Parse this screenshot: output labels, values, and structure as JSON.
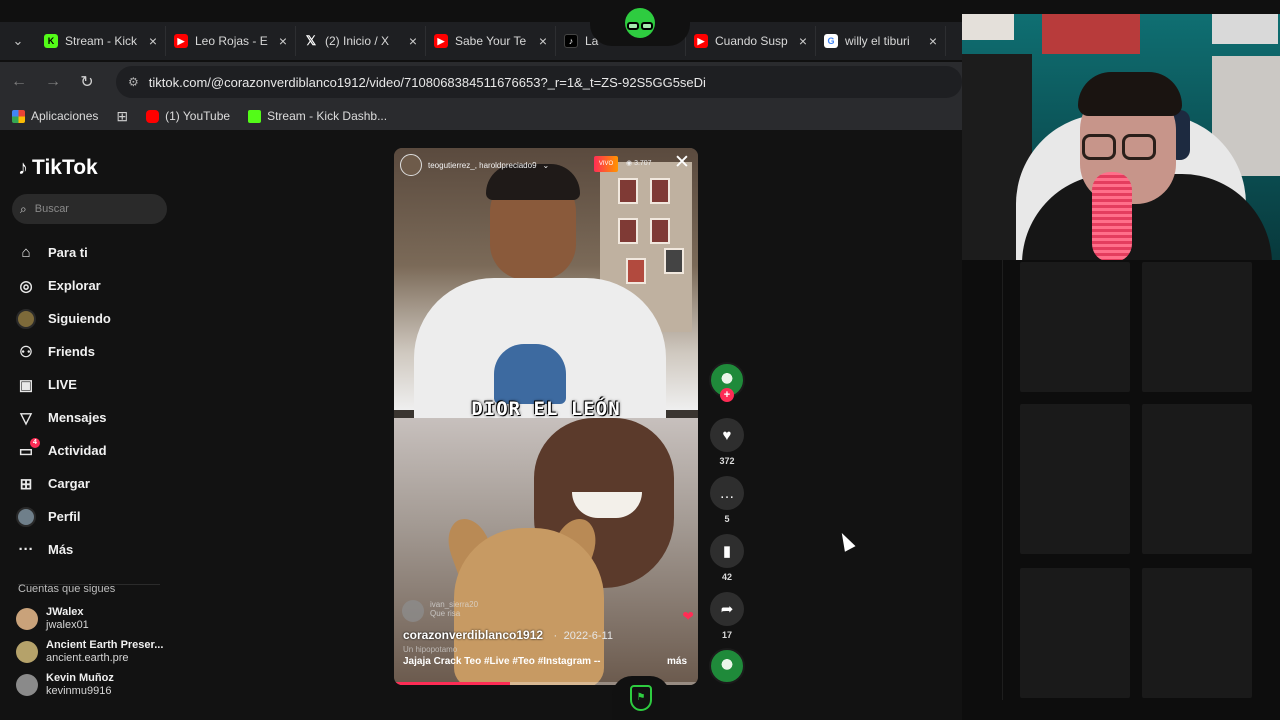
{
  "browser": {
    "tabs": [
      {
        "title": "Stream - Kick",
        "favicon": "kick-icon",
        "fav_text": "K"
      },
      {
        "title": "Leo Rojas - E",
        "favicon": "youtube-icon",
        "fav_text": "▶"
      },
      {
        "title": "(2) Inicio / X",
        "favicon": "x-icon",
        "fav_text": "𝕏"
      },
      {
        "title": "Sabe Your Te",
        "favicon": "youtube-icon",
        "fav_text": "▶"
      },
      {
        "title": "La",
        "favicon": "tiktok-icon",
        "fav_text": "♪"
      },
      {
        "title": "Cuando Susp",
        "favicon": "youtube-icon",
        "fav_text": "▶"
      },
      {
        "title": "willy el tiburi",
        "favicon": "google-icon",
        "fav_text": "G"
      }
    ],
    "url": "tiktok.com/@corazonverdiblanco1912/video/7108068384511676653?_r=1&_t=ZS-92S5GG5seDi",
    "bookmarks": [
      {
        "label": "Aplicaciones",
        "color": "#e74c3c"
      },
      {
        "label": "",
        "color": "#9aa0a6"
      },
      {
        "label": "(1) YouTube",
        "color": "#ff0000"
      },
      {
        "label": "Stream - Kick Dashb...",
        "color": "#53fc18"
      }
    ]
  },
  "tiktok": {
    "logo": "TikTok",
    "search_placeholder": "Buscar",
    "menu": [
      {
        "label": "Para ti",
        "icon": "home-icon",
        "glyph": "⌂"
      },
      {
        "label": "Explorar",
        "icon": "compass-icon",
        "glyph": "◎"
      },
      {
        "label": "Siguiendo",
        "icon": "following-avatar-icon",
        "glyph": "●"
      },
      {
        "label": "Friends",
        "icon": "friends-icon",
        "glyph": "⚇"
      },
      {
        "label": "LIVE",
        "icon": "live-icon",
        "glyph": "▣"
      },
      {
        "label": "Mensajes",
        "icon": "messages-icon",
        "glyph": "▽"
      },
      {
        "label": "Actividad",
        "icon": "activity-icon",
        "glyph": "▭",
        "badge": "4"
      },
      {
        "label": "Cargar",
        "icon": "upload-icon",
        "glyph": "⊞"
      },
      {
        "label": "Perfil",
        "icon": "profile-avatar-icon",
        "glyph": "●"
      },
      {
        "label": "Más",
        "icon": "more-icon",
        "glyph": "···"
      }
    ],
    "following_heading": "Cuentas que sigues",
    "following": [
      {
        "name": "JWalex",
        "handle": "jwalex01",
        "color": "#c9a27a"
      },
      {
        "name": "Ancient Earth Preser...",
        "handle": "ancient.earth.pre",
        "color": "#b5a26a"
      },
      {
        "name": "Kevin Muñoz",
        "handle": "kevinmu9916",
        "color": "#8a8a8a"
      }
    ]
  },
  "video": {
    "live_header": "teogutierrez_, haroldpreciado9",
    "live_badge": "VIVO",
    "viewers": "3.707",
    "overlay_caption": "DIOR EL LEÓN",
    "ghost_comment_user": "ivan_sierra20",
    "ghost_comment_text": "Que risa",
    "author": "corazonverdiblanco1912",
    "date": "2022-6-11",
    "sub_caption": "Un hipopotamo",
    "description": "Jajaja Crack Teo #Live #Teo #Instagram --",
    "more_label": "más",
    "progress": 0.38,
    "close_glyph": "✕"
  },
  "actions": {
    "likes": "372",
    "comments": "5",
    "saves": "42",
    "shares": "17",
    "follow_plus": "+"
  },
  "colors": {
    "accent": "#fe2c55",
    "overlay_green": "#2ecc40",
    "kick_green": "#53fc18"
  }
}
